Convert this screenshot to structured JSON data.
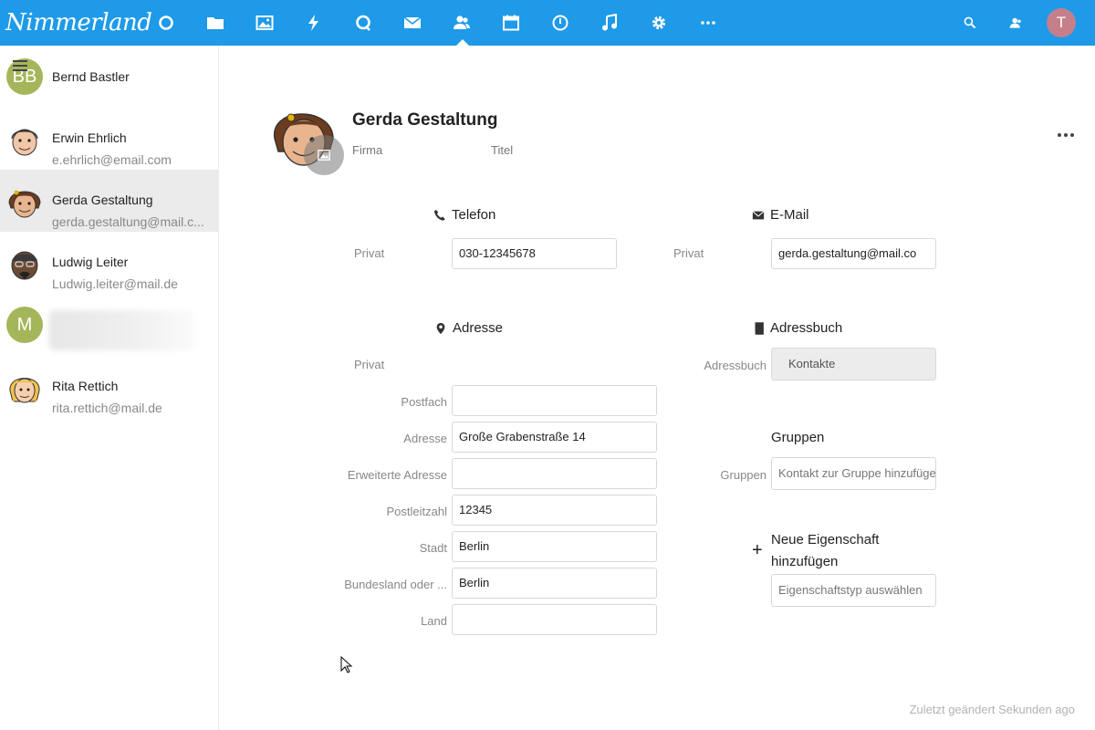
{
  "header": {
    "logo_text": "Nimmerland",
    "user_initial": "T",
    "colors": {
      "bar": "#1e9ae8",
      "user_avatar": "#c57f8b"
    },
    "apps": [
      "dashboard-icon",
      "files-icon",
      "photos-icon",
      "activity-icon",
      "talk-icon",
      "mail-icon",
      "contacts-icon",
      "calendar-icon",
      "clock-icon",
      "music-icon",
      "settings-icon",
      "more-apps-icon"
    ],
    "active_app": "contacts-icon"
  },
  "contacts": [
    {
      "name": "Bernd Bastler",
      "email": "",
      "initials": "BB"
    },
    {
      "name": "Erwin Ehrlich",
      "email": "e.ehrlich@email.com"
    },
    {
      "name": "Gerda Gestaltung",
      "email": "gerda.gestaltung@mail.c...",
      "active": true
    },
    {
      "name": "Ludwig Leiter",
      "email": "Ludwig.leiter@mail.de"
    },
    {
      "name": "",
      "email": "",
      "initials": "M"
    },
    {
      "name": "Rita Rettich",
      "email": "rita.rettich@mail.de"
    }
  ],
  "detail": {
    "full_name": "Gerda Gestaltung",
    "firma_placeholder": "Firma",
    "titel_placeholder": "Titel",
    "telefon": {
      "title": "Telefon",
      "label": "Privat",
      "value": "030-12345678"
    },
    "email": {
      "title": "E-Mail",
      "label": "Privat",
      "value": "gerda.gestaltung@mail.co"
    },
    "adresse": {
      "title": "Adresse",
      "type_label": "Privat",
      "fields": [
        {
          "label": "Postfach",
          "value": ""
        },
        {
          "label": "Adresse",
          "value": "Große Grabenstraße 14"
        },
        {
          "label": "Erweiterte Adresse",
          "value": ""
        },
        {
          "label": "Postleitzahl",
          "value": "12345"
        },
        {
          "label": "Stadt",
          "value": "Berlin"
        },
        {
          "label": "Bundesland oder ...",
          "value": "Berlin"
        },
        {
          "label": "Land",
          "value": ""
        }
      ]
    },
    "adressbuch": {
      "title": "Adressbuch",
      "label": "Adressbuch",
      "value": "Kontakte"
    },
    "gruppen": {
      "title": "Gruppen",
      "label": "Gruppen",
      "placeholder": "Kontakt zur Gruppe hinzufügen"
    },
    "new_property": {
      "label": "Neue Eigenschaft hinzufügen",
      "placeholder": "Eigenschaftstyp auswählen"
    }
  },
  "footer": {
    "last_modified": "Zuletzt geändert Sekunden ago"
  }
}
